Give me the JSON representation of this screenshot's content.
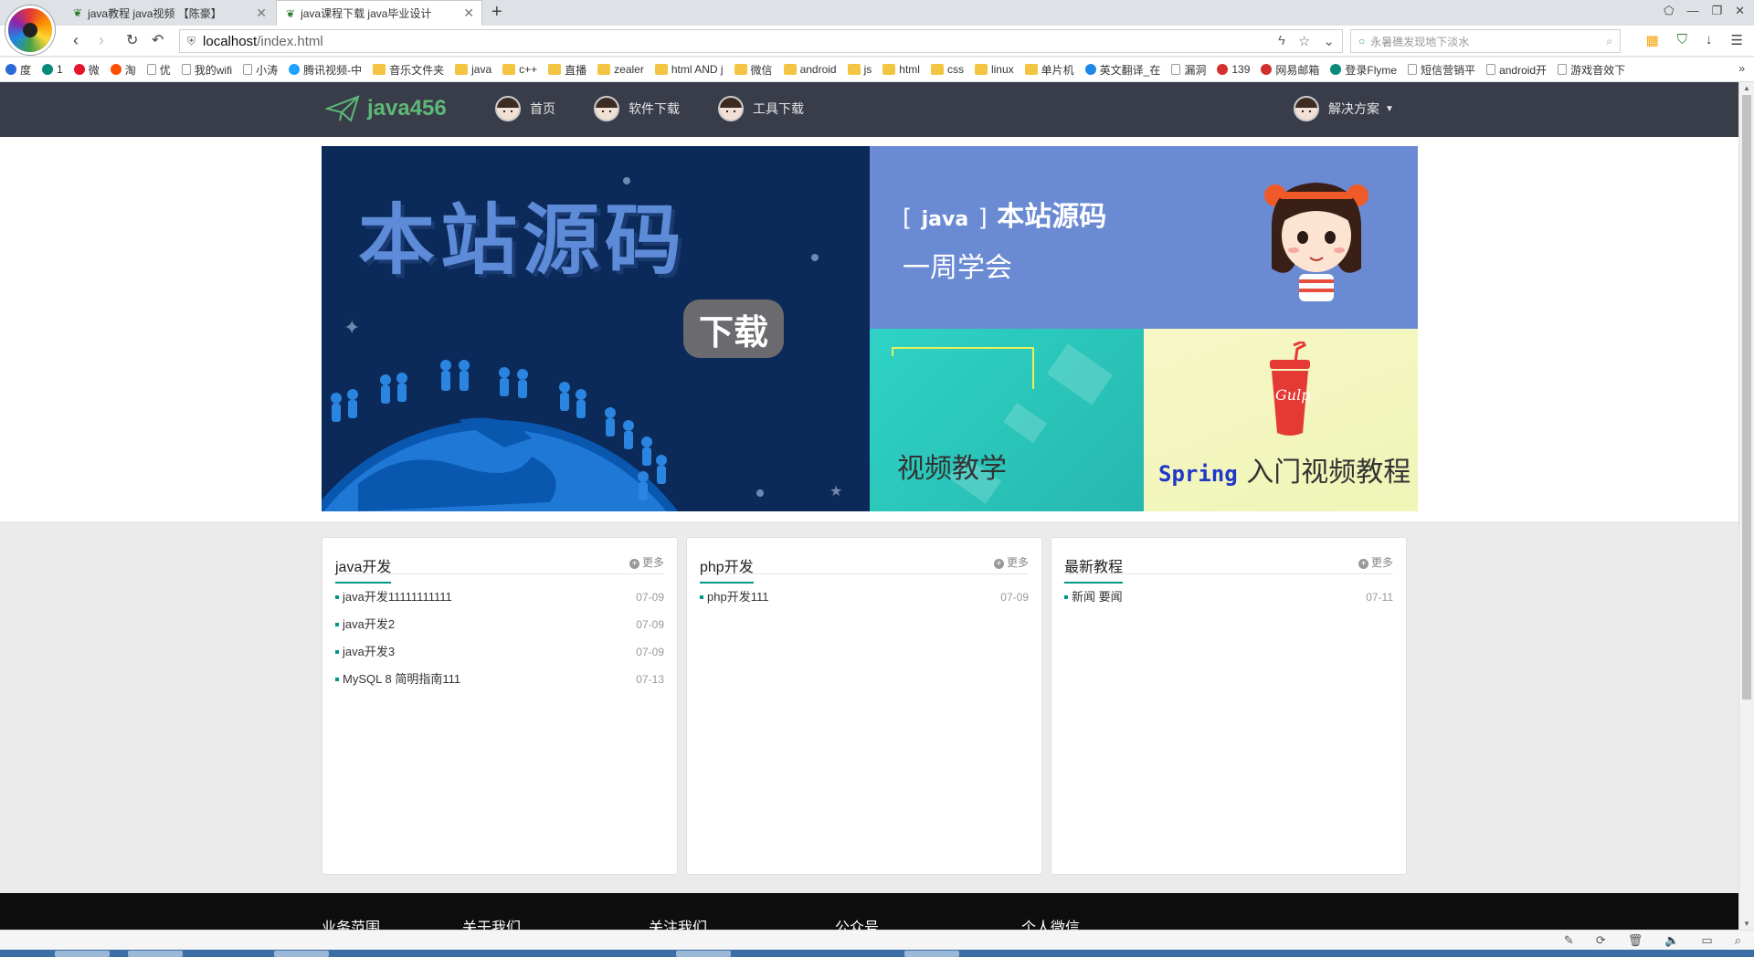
{
  "browser": {
    "tabs": [
      {
        "label": "java教程 java视频 【陈豪】"
      },
      {
        "label": "java课程下载 java毕业设计"
      }
    ],
    "new_tab": "+",
    "url_host": "localhost",
    "url_path": "/index.html",
    "search_placeholder": "永暑礁发现地下淡水",
    "bookmarks": [
      {
        "label": "度",
        "icon": "paw-icon"
      },
      {
        "label": "1",
        "icon": "dot-icon"
      },
      {
        "label": "微",
        "icon": "weibo-icon"
      },
      {
        "label": "淘",
        "icon": "taobao-icon"
      },
      {
        "label": "优",
        "icon": "page-icon"
      },
      {
        "label": "我的wifi",
        "icon": "page-icon"
      },
      {
        "label": "小涛",
        "icon": "page-icon"
      },
      {
        "label": "腾讯视频-中",
        "icon": "video-icon"
      },
      {
        "label": "音乐文件夹",
        "icon": "folder-icon"
      },
      {
        "label": "java",
        "icon": "folder-icon"
      },
      {
        "label": "c++",
        "icon": "folder-icon"
      },
      {
        "label": "直播",
        "icon": "folder-icon"
      },
      {
        "label": "zealer",
        "icon": "folder-icon"
      },
      {
        "label": "html AND j",
        "icon": "folder-icon"
      },
      {
        "label": "微信",
        "icon": "folder-icon"
      },
      {
        "label": "android",
        "icon": "folder-icon"
      },
      {
        "label": "js",
        "icon": "folder-icon"
      },
      {
        "label": "html",
        "icon": "folder-icon"
      },
      {
        "label": "css",
        "icon": "folder-icon"
      },
      {
        "label": "linux",
        "icon": "folder-icon"
      },
      {
        "label": "单片机",
        "icon": "folder-icon"
      },
      {
        "label": "英文翻译_在",
        "icon": "translate-icon"
      },
      {
        "label": "漏洞",
        "icon": "page-icon"
      },
      {
        "label": "139",
        "icon": "mail-icon"
      },
      {
        "label": "网易邮箱",
        "icon": "mail-icon"
      },
      {
        "label": "登录Flyme",
        "icon": "dot-icon"
      },
      {
        "label": "短信营销平",
        "icon": "page-icon"
      },
      {
        "label": "android开",
        "icon": "page-icon"
      },
      {
        "label": "游戏音效下",
        "icon": "page-icon"
      }
    ],
    "bookmarks_more": "»"
  },
  "site": {
    "logo_text": "java456",
    "nav": [
      {
        "label": "首页"
      },
      {
        "label": "软件下载"
      },
      {
        "label": "工具下载"
      }
    ],
    "nav_right": {
      "label": "解决方案"
    },
    "accent": "#5fb878",
    "header_bg": "#393d49",
    "theme": "#009688"
  },
  "banner": {
    "main_title": "本站源码",
    "main_button": "下载",
    "r1_bracket_open": "[",
    "r1_java": "java",
    "r1_bracket_close": "]",
    "r1_title": "本站源码",
    "r1_subtitle": "一周学会",
    "r2_label": "视频教学",
    "r3_spring": "Spring",
    "r3_label": "入门视频教程",
    "r3_cup_text": "Gulp"
  },
  "panels": [
    {
      "title": "java开发",
      "more": "更多",
      "items": [
        {
          "title": "java开发11111111111",
          "date": "07-09"
        },
        {
          "title": "java开发2",
          "date": "07-09"
        },
        {
          "title": "java开发3",
          "date": "07-09"
        },
        {
          "title": "MySQL 8 简明指南111",
          "date": "07-13"
        }
      ]
    },
    {
      "title": "php开发",
      "more": "更多",
      "items": [
        {
          "title": "php开发111",
          "date": "07-09"
        }
      ]
    },
    {
      "title": "最新教程",
      "more": "更多",
      "items": [
        {
          "title": "新闻 要闻",
          "date": "07-11"
        }
      ]
    }
  ],
  "footer": {
    "cols": [
      "业务范围",
      "关于我们",
      "关注我们",
      "公众号",
      "个人微信"
    ]
  }
}
